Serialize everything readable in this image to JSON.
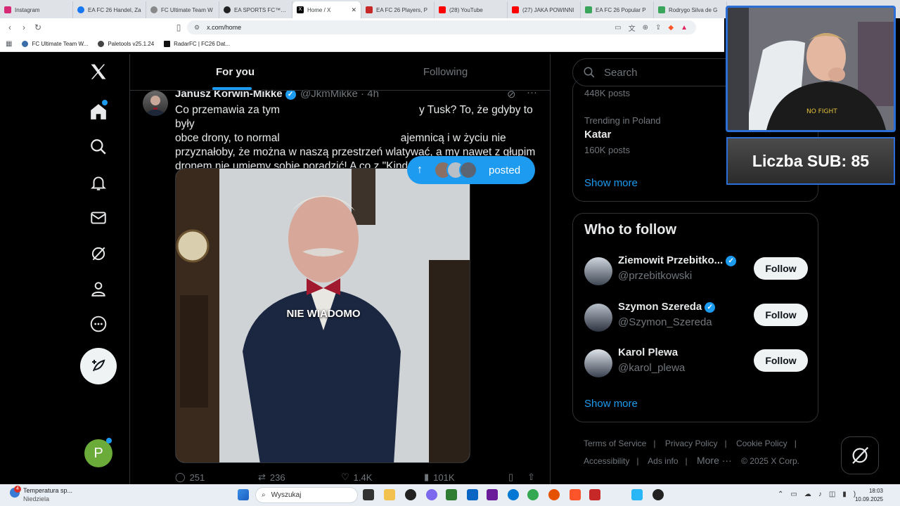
{
  "browser": {
    "tabs": [
      {
        "title": "Instagram",
        "color": "#d62976"
      },
      {
        "title": "EA FC 26 Handel, Za",
        "color": "#1877f2"
      },
      {
        "title": "FC Ultimate Team W",
        "color": "#888888"
      },
      {
        "title": "EA SPORTS FC™ 26",
        "color": "#222222"
      },
      {
        "title": "Home / X",
        "color": "#000000",
        "active": true
      },
      {
        "title": "EA FC 26 Players, P",
        "color": "#c62828"
      },
      {
        "title": "(28) YouTube",
        "color": "#ff0000"
      },
      {
        "title": "(27) JAKA POWINNI",
        "color": "#ff0000"
      },
      {
        "title": "EA FC 26 Popular P",
        "color": "#3ba55c"
      },
      {
        "title": "Rodrygo Silva de G",
        "color": "#3ba55c"
      }
    ],
    "url": "x.com/home",
    "bookmarks": [
      "FC Ultimate Team W...",
      "Paletools v25.1.24",
      "RadarFC | FC26 Dat..."
    ]
  },
  "feed": {
    "tab_for_you": "For you",
    "tab_following": "Following",
    "posted_pill": "posted",
    "tweet": {
      "author": "Janusz Korwin-Mikke",
      "handle": "@JkmMikke · 4h",
      "text": "Co przemawia za tym, że drony nie były... y Tusk? To, że gdyby to były obce drony, to normal... ajemnicą i w życiu nie przyznałoby, że można w naszą przestrzeń wlatywać, a my nawet z głupim dronem nie umiemy sobie poradzić! A co z \"Kindżałem\" lub \"Flamingo\"?",
      "text_line1": "Co przemawia za tym",
      "text_line1b": "y Tusk? To, że gdyby to były",
      "text_line2": "obce drony, to normal",
      "text_line2b": "ajemnicą i w życiu nie",
      "text_line3": "przyznałoby, że można w naszą przestrzeń wlatywać, a my nawet z głupim",
      "text_line4": "dronem nie umiemy sobie poradzić! A co z \"Kindżałem\" lub \"Flamingo\"?",
      "video_caption": "NIE WIADOMO",
      "replies": "251",
      "reposts": "236",
      "likes": "1.4K",
      "views": "101K"
    }
  },
  "sidebar": {
    "search_placeholder": "Search",
    "trend_prev_posts": "448K posts",
    "trend_context": "Trending in Poland",
    "trend_name": "Katar",
    "trend_posts": "160K posts",
    "show_more": "Show more",
    "who_to_follow": "Who to follow",
    "people": [
      {
        "name": "Ziemowit Przebitko...",
        "handle": "@przebitkowski",
        "follow": "Follow"
      },
      {
        "name": "Szymon Szereda",
        "handle": "@Szymon_Szereda",
        "follow": "Follow"
      },
      {
        "name": "Karol Plewa",
        "handle": "@karol_plewa",
        "follow": "Follow"
      }
    ],
    "show_more_2": "Show more",
    "footer": {
      "terms": "Terms of Service",
      "privacy": "Privacy Policy",
      "cookie": "Cookie Policy",
      "accessibility": "Accessibility",
      "ads": "Ads info",
      "more": "More ···",
      "copyright": "© 2025 X Corp."
    }
  },
  "overlay": {
    "sub_counter": "Liczba SUB: 85"
  },
  "taskbar": {
    "weather_title": "Temperatura sp...",
    "weather_sub": "Niedziela",
    "weather_badge": "4",
    "search": "Wyszukaj",
    "time": "18:03",
    "date": "10.09.2025"
  },
  "user_avatar_letter": "P"
}
